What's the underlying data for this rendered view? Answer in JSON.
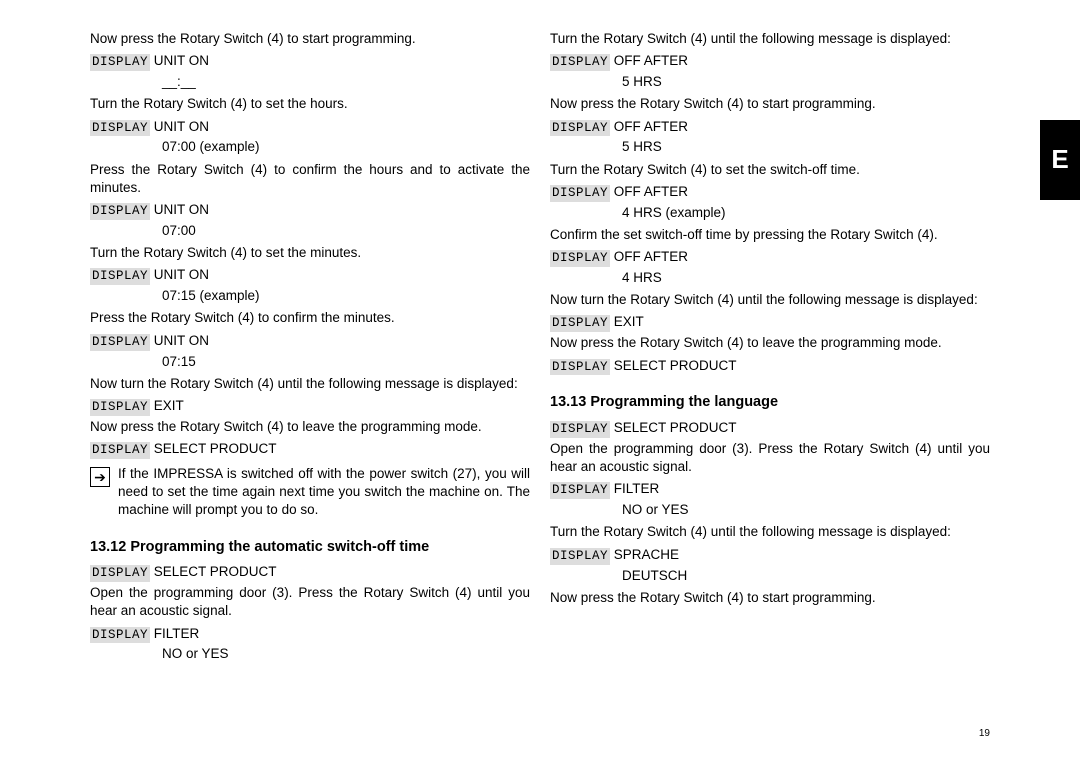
{
  "sideTab": "E",
  "pageNumber": "19",
  "left": {
    "p1": "Now press the Rotary Switch (4) to start programming.",
    "d1a": "UNIT ON",
    "d1b": "__:__",
    "p2": "Turn the Rotary Switch (4) to set the hours.",
    "d2a": "UNIT ON",
    "d2b": "07:00 (example)",
    "p3": "Press the Rotary Switch (4) to confirm the hours and to activate the minutes.",
    "d3a": "UNIT ON",
    "d3b": "07:00",
    "p4": "Turn the Rotary Switch (4) to set the minutes.",
    "d4a": "UNIT ON",
    "d4b": "07:15 (example)",
    "p5": "Press the Rotary Switch (4) to confirm the minutes.",
    "d5a": "UNIT ON",
    "d5b": "07:15",
    "p6": "Now turn the Rotary Switch (4) until the following message is displayed:",
    "d6a": "EXIT",
    "p7": "Now press the Rotary Switch (4) to leave the programming mode.",
    "d7a": "SELECT PRODUCT",
    "note": "If the IMPRESSA is switched off with the power switch (27), you will need to set the time again next time you switch the machine on. The machine will prompt you to do so.",
    "h1": "13.12 Programming the automatic switch-off time",
    "d8a": "SELECT PRODUCT",
    "p8": "Open the programming door (3). Press the Rotary Switch (4) until you hear an acoustic signal.",
    "d9a": "FILTER",
    "d9b": "NO or YES"
  },
  "right": {
    "p1": "Turn the Rotary Switch (4) until the following message is displayed:",
    "d1a": "OFF AFTER",
    "d1b": "5 HRS",
    "p2": "Now press the Rotary Switch (4) to start programming.",
    "d2a": "OFF AFTER",
    "d2b": "5 HRS",
    "p3": "Turn the Rotary Switch (4) to set the switch-off time.",
    "d3a": "OFF AFTER",
    "d3b": "4 HRS (example)",
    "p4": "Confirm the set switch-off time by pressing the Rotary Switch (4).",
    "d4a": "OFF AFTER",
    "d4b": "4 HRS",
    "p5": "Now turn the Rotary Switch (4) until the following message is displayed:",
    "d5a": "EXIT",
    "p6": "Now press the Rotary Switch (4) to leave the programming mode.",
    "d6a": "SELECT PRODUCT",
    "h1": "13.13 Programming the language",
    "d7a": "SELECT PRODUCT",
    "p7": "Open the programming door (3). Press the Rotary Switch (4) until you hear an acoustic signal.",
    "d8a": "FILTER",
    "d8b": "NO or YES",
    "p8": "Turn the Rotary Switch (4) until the following message is displayed:",
    "d9a": "SPRACHE",
    "d9b": "DEUTSCH",
    "p9": "Now press the Rotary Switch (4) to start programming."
  },
  "displayLabel": "DISPLAY"
}
